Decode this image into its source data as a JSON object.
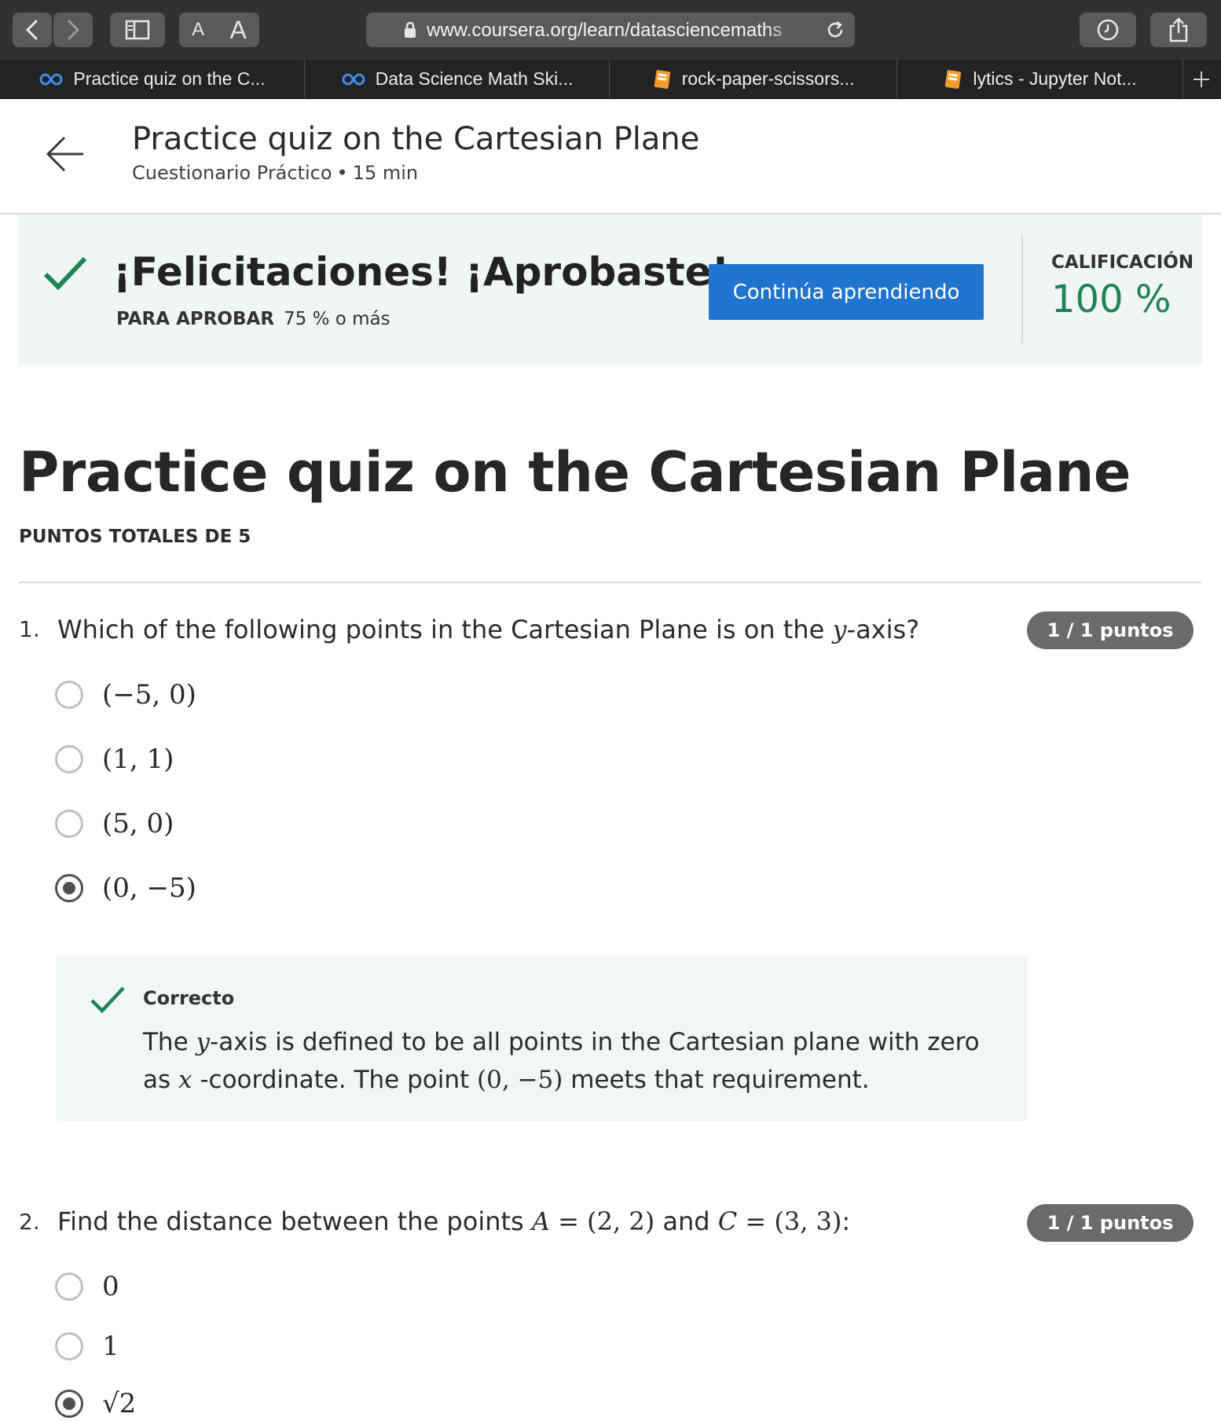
{
  "browser": {
    "url": "www.coursera.org/learn/datasciencemaths",
    "font_buttons": [
      "A",
      "A"
    ],
    "tabs": [
      {
        "label": "Practice quiz on the C...",
        "icon": "coursera-icon"
      },
      {
        "label": "Data Science Math Ski...",
        "icon": "coursera-icon"
      },
      {
        "label": "rock-paper-scissors...",
        "icon": "jupyter-book-icon"
      },
      {
        "label": "lytics - Jupyter Not...",
        "icon": "jupyter-book-icon"
      }
    ],
    "new_tab": "+"
  },
  "header": {
    "title": "Practice quiz on the Cartesian Plane",
    "type": "Cuestionario Práctico",
    "separator": "•",
    "duration": "15 min"
  },
  "result": {
    "message": "¡Felicitaciones! ¡Aprobaste!",
    "pass_label": "PARA APROBAR",
    "pass_value": "75 % o más",
    "continue_button": "Continúa aprendiendo",
    "grade_label": "CALIFICACIÓN",
    "grade_value": "100 %"
  },
  "quiz": {
    "title": "Practice quiz on the Cartesian Plane",
    "total_points": "PUNTOS TOTALES DE 5",
    "questions": [
      {
        "number": "1.",
        "text_pre": "Which of the following points in the Cartesian Plane is on the ",
        "text_var": "y",
        "text_post": "-axis?",
        "points": "1 / 1 puntos",
        "options": [
          "(−5, 0)",
          "(1, 1)",
          "(5, 0)",
          "(0, −5)"
        ],
        "selected_index": 3,
        "feedback": {
          "title": "Correcto",
          "t1": "The ",
          "v1": "y",
          "t2": "-axis is defined to be all points in the Cartesian plane with zero as ",
          "v2": "x",
          "t3": " -coordinate. The point ",
          "m1": "(0, −5)",
          "t4": " meets that requirement."
        }
      },
      {
        "number": "2.",
        "text_pre": "Find the distance between the points ",
        "var_a": "A",
        "eq_a": " = (2, 2)",
        "text_mid": " and ",
        "var_c": "C",
        "eq_c": " = (3, 3)",
        "text_post": ":",
        "points": "1 / 1 puntos",
        "options": [
          "0",
          "1",
          "√2"
        ],
        "selected_index": 2
      }
    ]
  },
  "colors": {
    "accent_blue": "#1f74d0",
    "success_green": "#1f8354",
    "banner_bg": "#eff6f4",
    "badge_gray": "#6a6a6a"
  }
}
